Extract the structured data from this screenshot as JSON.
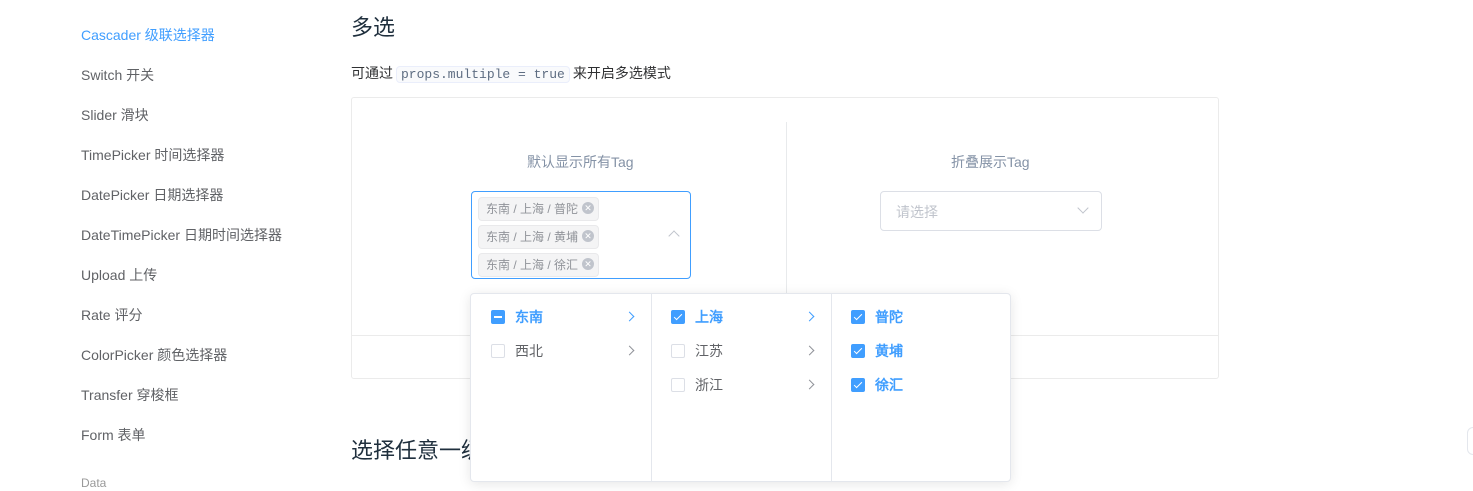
{
  "sidebar": {
    "items": [
      {
        "label": "Cascader 级联选择器",
        "active": true
      },
      {
        "label": "Switch 开关"
      },
      {
        "label": "Slider 滑块"
      },
      {
        "label": "TimePicker 时间选择器"
      },
      {
        "label": "DatePicker 日期选择器"
      },
      {
        "label": "DateTimePicker 日期时间选择器"
      },
      {
        "label": "Upload 上传"
      },
      {
        "label": "Rate 评分"
      },
      {
        "label": "ColorPicker 颜色选择器"
      },
      {
        "label": "Transfer 穿梭框"
      },
      {
        "label": "Form 表单"
      }
    ],
    "group_label": "Data"
  },
  "main": {
    "section_title": "多选",
    "desc_before": "可通过",
    "desc_code": "props.multiple = true",
    "desc_after": "来开启多选模式",
    "next_section_title": "选择任意一级"
  },
  "demo": {
    "left_label": "默认显示所有Tag",
    "right_label": "折叠展示Tag",
    "tags": [
      "东南 / 上海 / 普陀",
      "东南 / 上海 / 黄埔",
      "东南 / 上海 / 徐汇"
    ],
    "tag_close_icon": "✕",
    "right_placeholder": "请选择"
  },
  "dropdown": {
    "menu1": [
      {
        "label": "东南",
        "state": "indeterminate",
        "active": true
      },
      {
        "label": "西北",
        "state": "unchecked"
      }
    ],
    "menu2": [
      {
        "label": "上海",
        "state": "checked",
        "active": true
      },
      {
        "label": "江苏",
        "state": "unchecked"
      },
      {
        "label": "浙江",
        "state": "unchecked"
      }
    ],
    "menu3": [
      {
        "label": "普陀",
        "state": "checked"
      },
      {
        "label": "黄埔",
        "state": "checked"
      },
      {
        "label": "徐汇",
        "state": "checked"
      }
    ]
  },
  "colors": {
    "accent": "#409EFF",
    "border": "#dcdfe6",
    "text": "#606266"
  }
}
